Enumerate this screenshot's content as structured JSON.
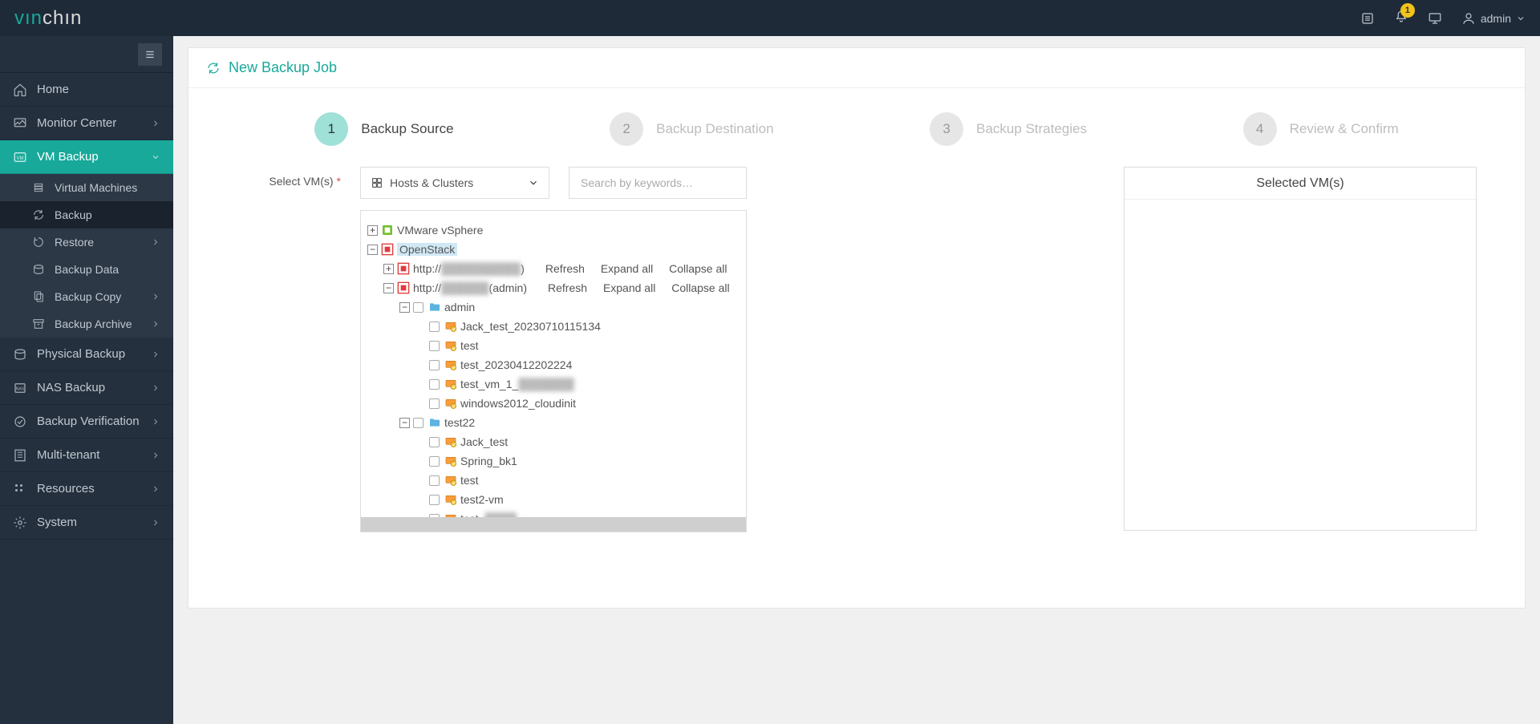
{
  "brand": {
    "part1": "vın",
    "part2": "chın"
  },
  "topbar": {
    "notification_count": "1",
    "user": "admin"
  },
  "sidebar": {
    "items": [
      {
        "label": "Home",
        "icon": "home"
      },
      {
        "label": "Monitor Center",
        "icon": "monitor",
        "expandable": true
      },
      {
        "label": "VM Backup",
        "icon": "vm",
        "expandable": true,
        "active": true,
        "children": [
          {
            "label": "Virtual Machines",
            "icon": "stack"
          },
          {
            "label": "Backup",
            "icon": "refresh",
            "selected": true
          },
          {
            "label": "Restore",
            "icon": "restore",
            "expandable": true
          },
          {
            "label": "Backup Data",
            "icon": "disk"
          },
          {
            "label": "Backup Copy",
            "icon": "copy",
            "expandable": true
          },
          {
            "label": "Backup Archive",
            "icon": "archive",
            "expandable": true
          }
        ]
      },
      {
        "label": "Physical Backup",
        "icon": "disk",
        "expandable": true
      },
      {
        "label": "NAS Backup",
        "icon": "nas",
        "expandable": true
      },
      {
        "label": "Backup Verification",
        "icon": "verify",
        "expandable": true
      },
      {
        "label": "Multi-tenant",
        "icon": "tenant",
        "expandable": true
      },
      {
        "label": "Resources",
        "icon": "resources",
        "expandable": true
      },
      {
        "label": "System",
        "icon": "system",
        "expandable": true
      }
    ]
  },
  "page": {
    "title": "New Backup Job",
    "steps": [
      {
        "num": "1",
        "label": "Backup Source",
        "active": true
      },
      {
        "num": "2",
        "label": "Backup Destination"
      },
      {
        "num": "3",
        "label": "Backup Strategies"
      },
      {
        "num": "4",
        "label": "Review & Confirm"
      }
    ]
  },
  "form": {
    "select_vms_label": "Select VM(s)",
    "view_selector": "Hosts & Clusters",
    "search_placeholder": "Search by keywords…",
    "selected_panel_title": "Selected VM(s)"
  },
  "tree": {
    "actions": {
      "refresh": "Refresh",
      "expand": "Expand all",
      "collapse": "Collapse all"
    },
    "root": [
      {
        "type": "platform",
        "platform": "vmware",
        "label": "VMware vSphere",
        "expanded": false
      },
      {
        "type": "platform",
        "platform": "openstack",
        "label": "OpenStack",
        "expanded": true,
        "highlight": true,
        "children": [
          {
            "type": "host",
            "platform": "openstack",
            "label_prefix": "http://",
            "label_blur": "██████████",
            "label_suffix": ")",
            "expanded": false,
            "actions": true
          },
          {
            "type": "host",
            "platform": "openstack",
            "label_prefix": "http://",
            "label_blur": "██████",
            "label_suffix": "(admin)",
            "expanded": true,
            "actions": true,
            "children": [
              {
                "type": "folder",
                "label": "admin",
                "expanded": true,
                "children": [
                  {
                    "type": "vm",
                    "label": "Jack_test_20230710115134"
                  },
                  {
                    "type": "vm",
                    "label": "test"
                  },
                  {
                    "type": "vm",
                    "label": "test_20230412202224"
                  },
                  {
                    "type": "vm",
                    "label_prefix": "test_vm_1_",
                    "label_blur": "███████"
                  },
                  {
                    "type": "vm",
                    "label": "windows2012_cloudinit"
                  }
                ]
              },
              {
                "type": "folder",
                "label": "test22",
                "expanded": true,
                "children": [
                  {
                    "type": "vm",
                    "label": "Jack_test"
                  },
                  {
                    "type": "vm",
                    "label": "Spring_bk1"
                  },
                  {
                    "type": "vm",
                    "label": "test"
                  },
                  {
                    "type": "vm",
                    "label": "test2-vm"
                  },
                  {
                    "type": "vm",
                    "label_prefix": "test_",
                    "label_blur": "████"
                  }
                ]
              }
            ]
          }
        ]
      }
    ]
  }
}
